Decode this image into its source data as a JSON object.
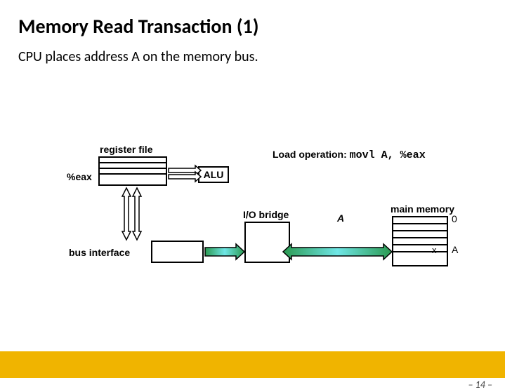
{
  "title": "Memory Read Transaction (1)",
  "subtitle": "CPU places address A on the memory bus.",
  "labels": {
    "register_file": "register file",
    "eax": "%eax",
    "alu": "ALU",
    "bus_interface": "bus interface",
    "io_bridge": "I/O bridge",
    "main_memory": "main memory",
    "load_op_prefix": "Load operation:",
    "load_op_code": "movl A, %eax",
    "addr_A": "A",
    "mem_zero": "0",
    "mem_x": "x",
    "mem_A": "A"
  },
  "footer": {
    "pagenum": "– 14 –"
  }
}
